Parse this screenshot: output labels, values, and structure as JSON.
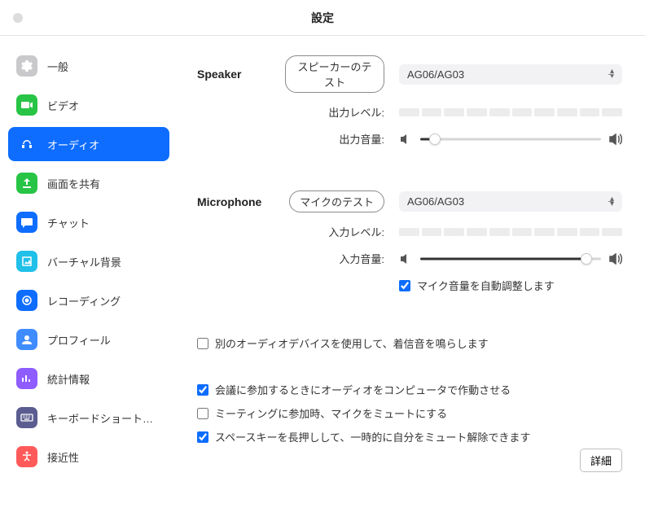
{
  "window": {
    "title": "設定"
  },
  "sidebar": {
    "items": [
      {
        "label": "一般",
        "icon": "gear",
        "color": "#c9c9cc"
      },
      {
        "label": "ビデオ",
        "icon": "video",
        "color": "#28c445"
      },
      {
        "label": "オーディオ",
        "icon": "audio",
        "color": "#0e6dff",
        "active": true
      },
      {
        "label": "画面を共有",
        "icon": "share",
        "color": "#28c445"
      },
      {
        "label": "チャット",
        "icon": "chat",
        "color": "#0e6dff"
      },
      {
        "label": "バーチャル背景",
        "icon": "virtual",
        "color": "#20c0e8"
      },
      {
        "label": "レコーディング",
        "icon": "record",
        "color": "#0e6dff"
      },
      {
        "label": "プロフィール",
        "icon": "profile",
        "color": "#3f8cff"
      },
      {
        "label": "統計情報",
        "icon": "stats",
        "color": "#8e5cff"
      },
      {
        "label": "キーボードショートカ…",
        "icon": "keyboard",
        "color": "#5b5c8f"
      },
      {
        "label": "接近性",
        "icon": "access",
        "color": "#ff5a5a"
      }
    ]
  },
  "speaker": {
    "heading": "Speaker",
    "test_label": "スピーカーのテスト",
    "device": "AG06/AG03",
    "output_level_label": "出力レベル:",
    "output_volume_label": "出力音量:",
    "volume_percent": 8
  },
  "microphone": {
    "heading": "Microphone",
    "test_label": "マイクのテスト",
    "device": "AG06/AG03",
    "input_level_label": "入力レベル:",
    "input_volume_label": "入力音量:",
    "volume_percent": 92,
    "auto_adjust_label": "マイク音量を自動調整します",
    "auto_adjust_checked": true
  },
  "options": {
    "ring_separate": {
      "label": "別のオーディオデバイスを使用して、着信音を鳴らします",
      "checked": false
    },
    "join_audio": {
      "label": "会議に参加するときにオーディオをコンピュータで作動させる",
      "checked": true
    },
    "mute_on_join": {
      "label": "ミーティングに参加時、マイクをミュートにする",
      "checked": false
    },
    "space_unmute": {
      "label": "スペースキーを長押しして、一時的に自分をミュート解除できます",
      "checked": true
    }
  },
  "advanced_label": "詳細"
}
